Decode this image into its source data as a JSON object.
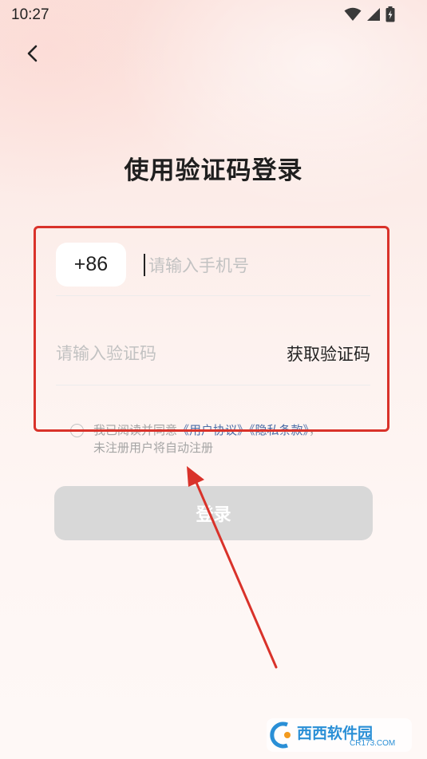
{
  "status_bar": {
    "time": "10:27"
  },
  "header": {
    "back_icon": "chevron-left-icon"
  },
  "title": "使用验证码登录",
  "form": {
    "country_code": "+86",
    "phone_placeholder": "请输入手机号",
    "code_placeholder": "请输入验证码",
    "get_code_label": "获取验证码"
  },
  "agreement": {
    "prefix": "我已阅读并同意",
    "user_agreement": "《用户协议》",
    "privacy_policy": "《隐私条款》",
    "separator": "，",
    "note": "未注册用户将自动注册"
  },
  "login_button": {
    "label": "登录"
  },
  "annotation": {
    "color": "#d9322a"
  },
  "watermark": {
    "brand": "西西软件园",
    "domain": "CR173.COM"
  }
}
